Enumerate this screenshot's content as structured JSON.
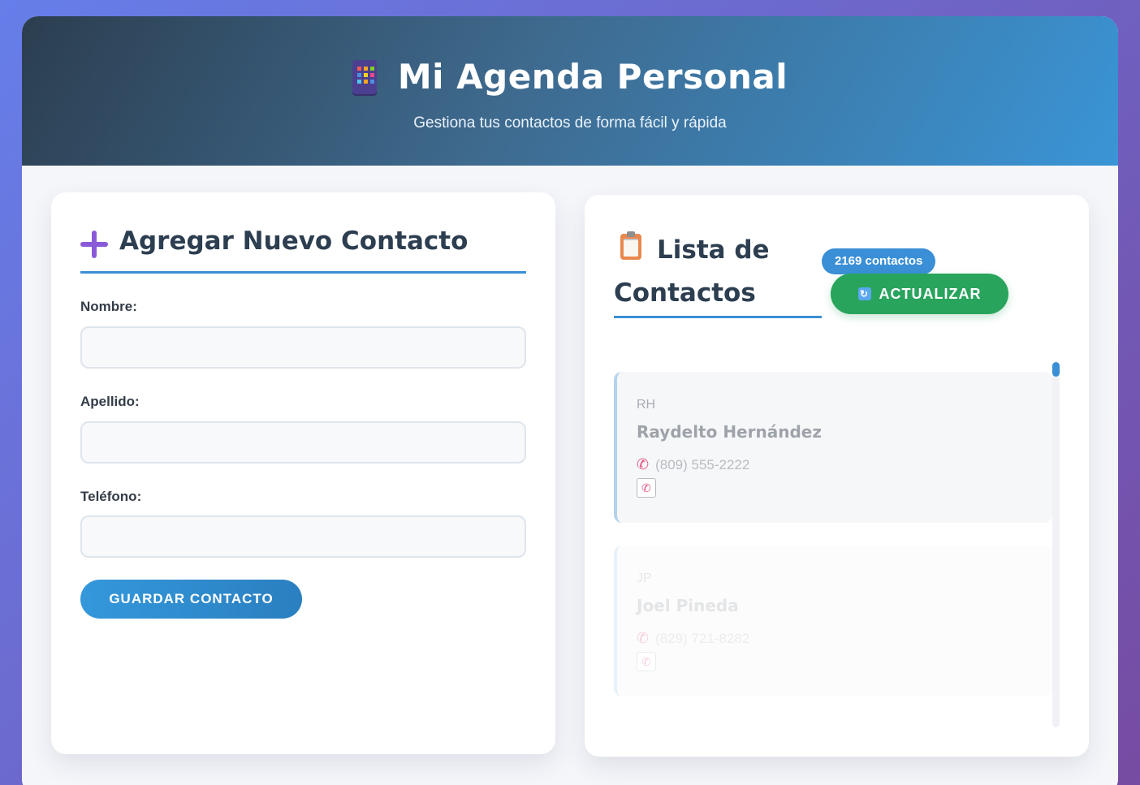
{
  "header": {
    "icon": "building-icon",
    "title": "Mi Agenda Personal",
    "subtitle": "Gestiona tus contactos de forma fácil y rápida"
  },
  "form": {
    "heading_icon": "plus-icon",
    "heading": "Agregar Nuevo Contacto",
    "fields": [
      {
        "label": "Nombre:",
        "value": ""
      },
      {
        "label": "Apellido:",
        "value": ""
      },
      {
        "label": "Teléfono:",
        "value": ""
      }
    ],
    "save_label": "Guardar Contacto"
  },
  "list": {
    "heading_icon": "clipboard-icon",
    "heading": "Lista de Contactos",
    "count_badge": "2169 contactos",
    "refresh_icon": "refresh-icon",
    "refresh_label": "ACTUALIZAR",
    "contacts": [
      {
        "initials": "RH",
        "name": "Raydelto Hernández",
        "phone": "(809) 555-2222"
      },
      {
        "initials": "JP",
        "name": "Joel Pineda",
        "phone": "(829) 721-8282"
      }
    ]
  },
  "colors": {
    "accent": "#3a8fd6",
    "success": "#28a45c",
    "background_gradient_start": "#667eea",
    "background_gradient_end": "#764ba2"
  }
}
